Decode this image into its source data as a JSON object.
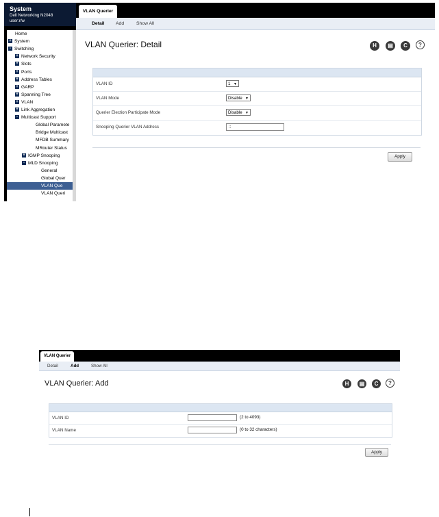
{
  "sidebar": {
    "header_title": "System",
    "device": "Dell Networking N2048",
    "user": "user:r/w",
    "tree": [
      {
        "label": "Home",
        "indent": 0,
        "toggle": "",
        "selected": false
      },
      {
        "label": "System",
        "indent": 0,
        "toggle": "+",
        "selected": false
      },
      {
        "label": "Switching",
        "indent": 0,
        "toggle": "-",
        "selected": false
      },
      {
        "label": "Network Security",
        "indent": 1,
        "toggle": "+",
        "selected": false
      },
      {
        "label": "Slots",
        "indent": 1,
        "toggle": "+",
        "selected": false
      },
      {
        "label": "Ports",
        "indent": 1,
        "toggle": "+",
        "selected": false
      },
      {
        "label": "Address Tables",
        "indent": 1,
        "toggle": "+",
        "selected": false
      },
      {
        "label": "GARP",
        "indent": 1,
        "toggle": "+",
        "selected": false
      },
      {
        "label": "Spanning Tree",
        "indent": 1,
        "toggle": "+",
        "selected": false
      },
      {
        "label": "VLAN",
        "indent": 1,
        "toggle": "+",
        "selected": false
      },
      {
        "label": "Link Aggregation",
        "indent": 1,
        "toggle": "+",
        "selected": false
      },
      {
        "label": "Multicast Support",
        "indent": 1,
        "toggle": "-",
        "selected": false
      },
      {
        "label": "Global Paramete",
        "indent": 2,
        "toggle": "",
        "selected": false
      },
      {
        "label": "Bridge Multicast",
        "indent": 2,
        "toggle": "",
        "selected": false
      },
      {
        "label": "MFDB Summary",
        "indent": 2,
        "toggle": "",
        "selected": false
      },
      {
        "label": "MRouter Status",
        "indent": 2,
        "toggle": "",
        "selected": false
      },
      {
        "label": "IGMP Snooping",
        "indent": 2,
        "toggle": "+",
        "selected": false
      },
      {
        "label": "MLD Snooping",
        "indent": 2,
        "toggle": "-",
        "selected": false
      },
      {
        "label": "General",
        "indent": 3,
        "toggle": "",
        "selected": false
      },
      {
        "label": "Global Quer",
        "indent": 3,
        "toggle": "",
        "selected": false
      },
      {
        "label": "VLAN Que",
        "indent": 3,
        "toggle": "",
        "selected": true
      },
      {
        "label": "VLAN Queri",
        "indent": 3,
        "toggle": "",
        "selected": false
      }
    ]
  },
  "detail": {
    "tab_label": "VLAN Querier",
    "subtabs": [
      "Detail",
      "Add",
      "Show All"
    ],
    "title": "VLAN Querier: Detail",
    "fields": {
      "vlan_id_label": "VLAN ID",
      "vlan_id_value": "1",
      "vlan_mode_label": "VLAN Mode",
      "vlan_mode_value": "Disable",
      "election_label": "Querier Election Participate Mode",
      "election_value": "Disable",
      "address_label": "Snooping Querier VLAN Address",
      "address_value": "::"
    },
    "apply_label": "Apply"
  },
  "add": {
    "tab_label": "VLAN Querier",
    "subtabs": [
      "Detail",
      "Add",
      "Show All"
    ],
    "title": "VLAN Querier: Add",
    "fields": {
      "vlan_id_label": "VLAN ID",
      "vlan_id_value": "",
      "vlan_id_hint": "(2 to 4093)",
      "vlan_name_label": "VLAN Name",
      "vlan_name_value": "",
      "vlan_name_hint": "(0 to 32 characters)"
    },
    "apply_label": "Apply"
  },
  "icons": {
    "save": "save-icon",
    "print": "print-icon",
    "refresh": "refresh-icon",
    "help": "help-icon"
  },
  "colors": {
    "sidebar_header": "#0c1a33",
    "selected_row": "#3d5f93",
    "panel_header": "#dce6f2",
    "topbar": "#000000"
  }
}
